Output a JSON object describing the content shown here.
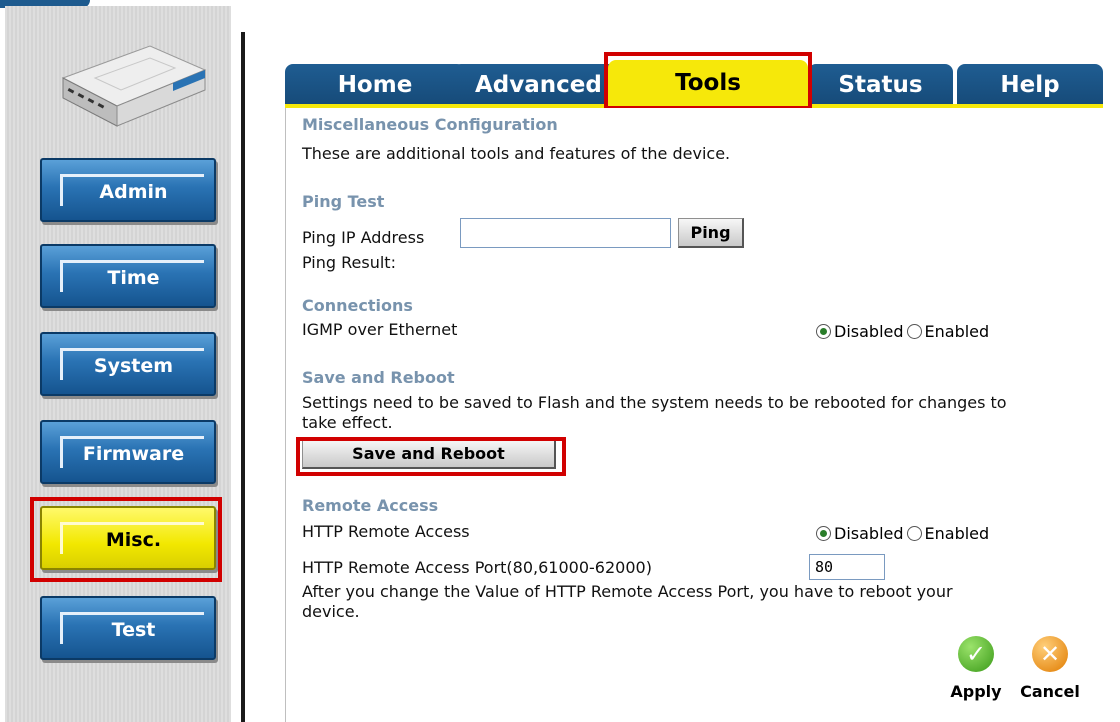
{
  "tabs": [
    "Home",
    "Advanced",
    "Tools",
    "Status",
    "Help"
  ],
  "sidebar": {
    "items": [
      "Admin",
      "Time",
      "System",
      "Firmware",
      "Misc.",
      "Test"
    ],
    "active": "Misc."
  },
  "misc": {
    "title": "Miscellaneous Configuration",
    "desc": "These are additional tools and features of the device."
  },
  "ping": {
    "title": "Ping Test",
    "ip_label": "Ping IP Address",
    "ip_value": "",
    "button": "Ping",
    "result_label": "Ping Result:"
  },
  "connections": {
    "title": "Connections",
    "igmp_label": "IGMP over Ethernet",
    "option_disabled": "Disabled",
    "option_enabled": "Enabled",
    "selected": "Disabled"
  },
  "save": {
    "title": "Save and Reboot",
    "desc_line1": "Settings need to be saved to Flash and the system needs to be rebooted for changes to",
    "desc_line2": "take effect.",
    "button": "Save and Reboot"
  },
  "remote": {
    "title": "Remote Access",
    "http_label": "HTTP Remote Access",
    "option_disabled": "Disabled",
    "option_enabled": "Enabled",
    "selected": "Disabled",
    "port_label": "HTTP Remote Access Port(80,61000-62000)",
    "port_value": "80",
    "note_line1": "After you change the Value of HTTP Remote Access Port, you have to reboot your",
    "note_line2": "device."
  },
  "actions": {
    "apply": "Apply",
    "cancel": "Cancel"
  },
  "colors": {
    "accent_yellow": "#f6e80a",
    "tab_blue": "#1f5d92",
    "section_title": "#7893ad",
    "highlight_red": "#d10000"
  }
}
